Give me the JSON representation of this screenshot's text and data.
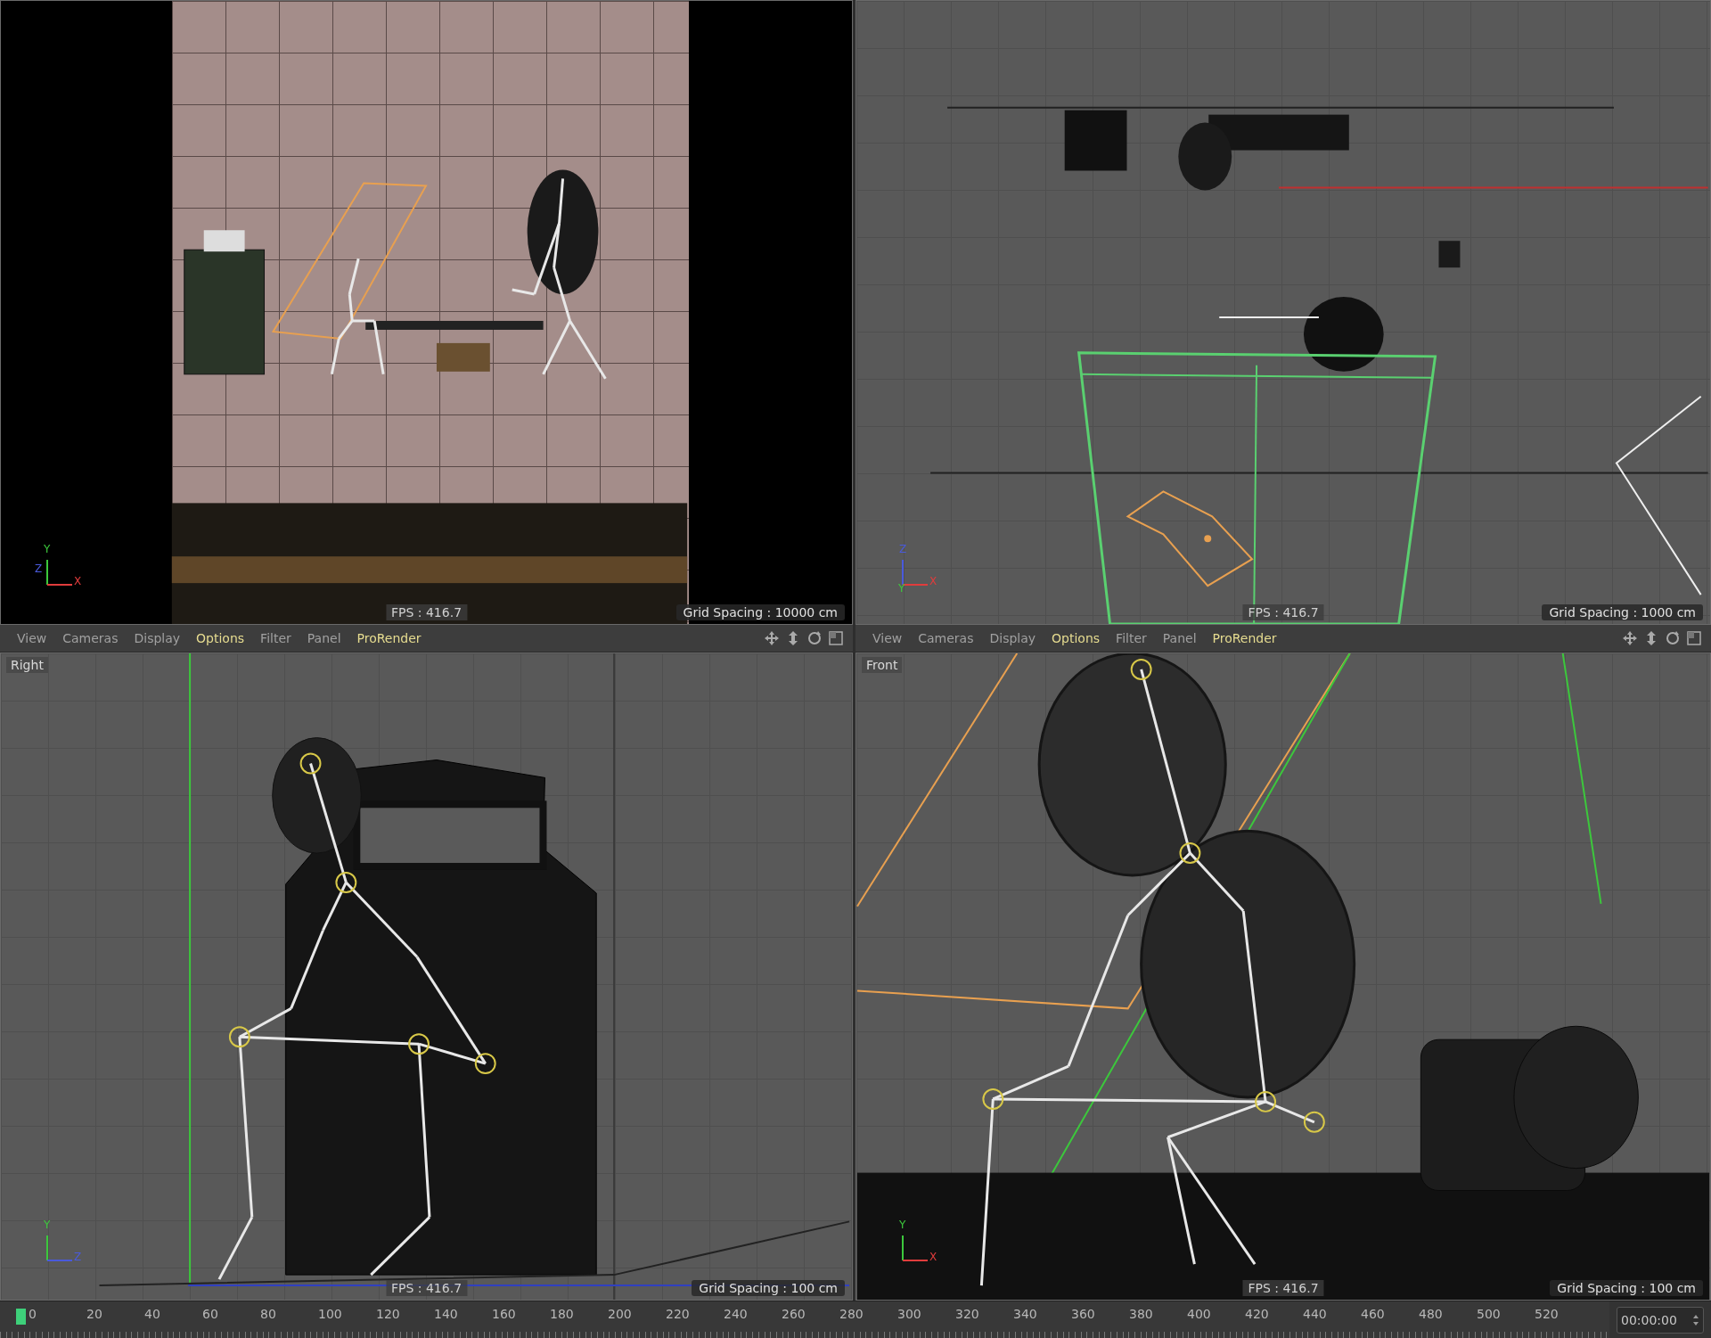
{
  "viewports": [
    {
      "kind": "render",
      "fps": "FPS : 416.7",
      "grid_spacing": "Grid Spacing : 10000 cm",
      "axes": [
        {
          "label": "Y",
          "color": "#3cc83c"
        },
        {
          "label": "Z",
          "color": "#4a5adc"
        },
        {
          "label": "X",
          "color": "#e03c3c"
        }
      ]
    },
    {
      "kind": "top",
      "fps": "FPS : 416.7",
      "grid_spacing": "Grid Spacing : 1000 cm",
      "axes": [
        {
          "label": "Z",
          "color": "#4a5adc"
        },
        {
          "label": "Y",
          "color": "#3cc83c"
        },
        {
          "label": "X",
          "color": "#e03c3c"
        }
      ]
    },
    {
      "kind": "right",
      "menu": [
        {
          "label": "View",
          "highlighted": false
        },
        {
          "label": "Cameras",
          "highlighted": false
        },
        {
          "label": "Display",
          "highlighted": false
        },
        {
          "label": "Options",
          "highlighted": true
        },
        {
          "label": "Filter",
          "highlighted": false
        },
        {
          "label": "Panel",
          "highlighted": false
        },
        {
          "label": "ProRender",
          "highlighted": true
        }
      ],
      "label": "Right",
      "fps": "FPS : 416.7",
      "grid_spacing": "Grid Spacing : 100 cm",
      "axes": [
        {
          "label": "Y",
          "color": "#3cc83c"
        },
        {
          "label": "Z",
          "color": "#4a5adc"
        }
      ]
    },
    {
      "kind": "front",
      "menu": [
        {
          "label": "View",
          "highlighted": false
        },
        {
          "label": "Cameras",
          "highlighted": false
        },
        {
          "label": "Display",
          "highlighted": false
        },
        {
          "label": "Options",
          "highlighted": true
        },
        {
          "label": "Filter",
          "highlighted": false
        },
        {
          "label": "Panel",
          "highlighted": false
        },
        {
          "label": "ProRender",
          "highlighted": true
        }
      ],
      "label": "Front",
      "fps": "FPS : 416.7",
      "grid_spacing": "Grid Spacing : 100 cm",
      "axes": [
        {
          "label": "Y",
          "color": "#3cc83c"
        },
        {
          "label": "X",
          "color": "#e03c3c"
        }
      ]
    }
  ],
  "timeline": {
    "ticks": [
      "0",
      "20",
      "40",
      "60",
      "80",
      "100",
      "120",
      "140",
      "160",
      "180",
      "200",
      "220",
      "240",
      "260",
      "280",
      "300",
      "320",
      "340",
      "360",
      "380",
      "400",
      "420",
      "440",
      "460",
      "480",
      "500",
      "520"
    ],
    "time": "00:00:00"
  }
}
